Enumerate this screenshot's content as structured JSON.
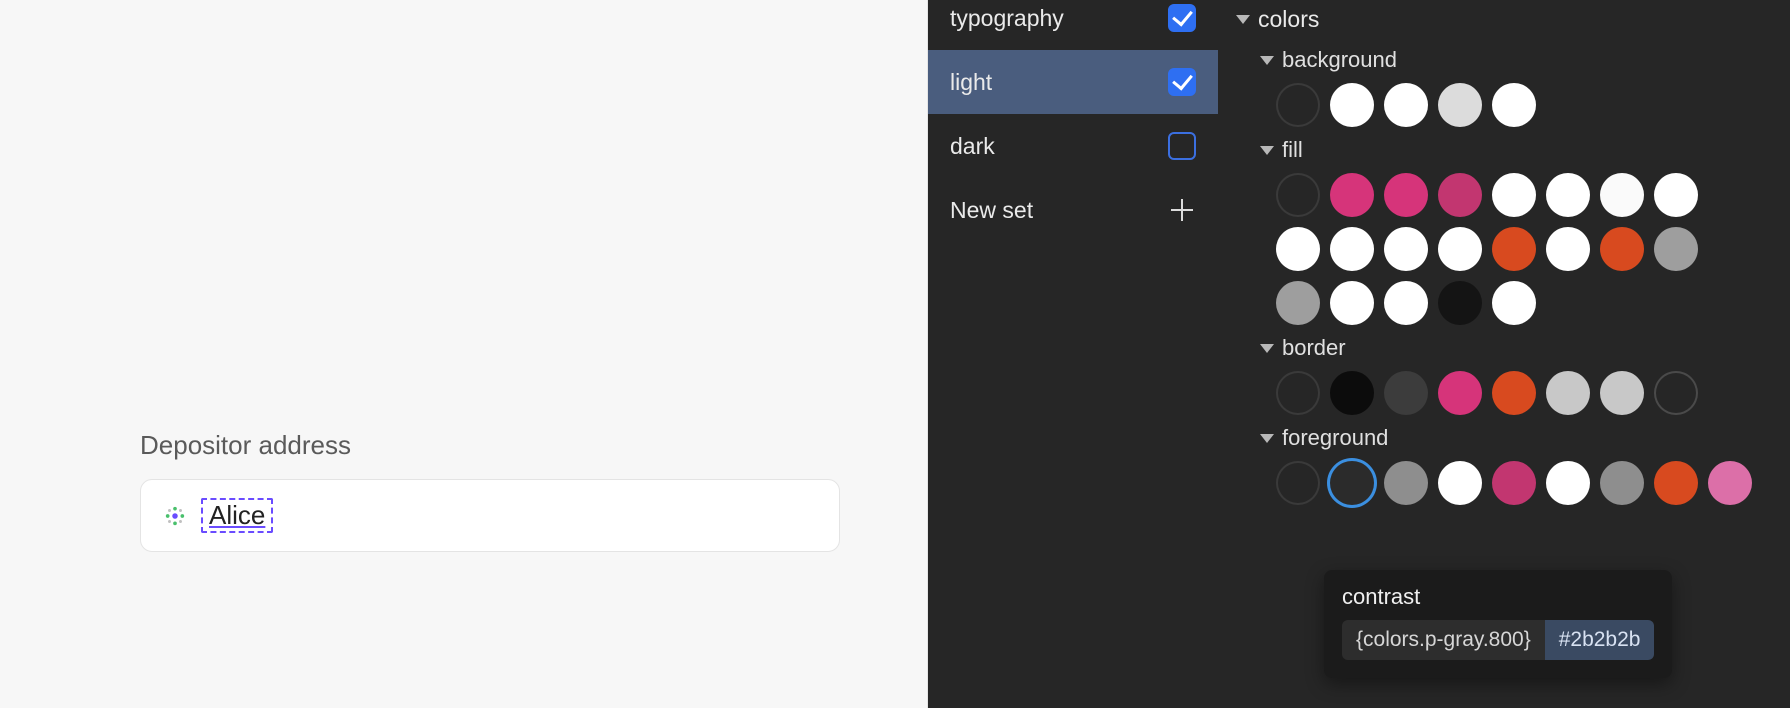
{
  "canvas": {
    "form": {
      "label": "Depositor address",
      "value": "Alice"
    }
  },
  "sets": {
    "items": [
      {
        "label": "typography",
        "checked": true,
        "active": false
      },
      {
        "label": "light",
        "checked": true,
        "active": true
      },
      {
        "label": "dark",
        "checked": false,
        "active": false
      }
    ],
    "new_label": "New set"
  },
  "tree": {
    "root_label": "colors",
    "groups": {
      "background": {
        "label": "background",
        "swatches": [
          "#ffffff",
          "#ffffff",
          "#dcdcdc",
          "#ffffff"
        ]
      },
      "fill": {
        "label": "fill",
        "swatches": [
          "#d6347a",
          "#d6347a",
          "#c23670",
          "#ffffff",
          "#ffffff",
          "#fafafa",
          "#ffffff",
          "#ffffff",
          "#ffffff",
          "#ffffff",
          "#ffffff",
          "#d84a1f",
          "#ffffff",
          "#d84a1f",
          "#9e9e9e",
          "#9e9e9e",
          "#ffffff",
          "#ffffff",
          "#141414",
          "#ffffff"
        ]
      },
      "border": {
        "label": "border",
        "swatches": [
          "#0c0c0c",
          "#3c3c3c",
          "#d6347a",
          "#d84a1f",
          "#c8c8c8",
          "#c8c8c8"
        ],
        "trailing_outline": true
      },
      "foreground": {
        "label": "foreground",
        "swatches": [
          "#2b2b2b",
          "#8e8e8e",
          "#ffffff",
          "#c23670",
          "#ffffff",
          "#8e8e8e",
          "#d84a1f",
          "#dc6fa8"
        ],
        "selected_index": 0
      }
    }
  },
  "tooltip": {
    "title": "contrast",
    "reference": "{colors.p-gray.800}",
    "value": "#2b2b2b"
  }
}
